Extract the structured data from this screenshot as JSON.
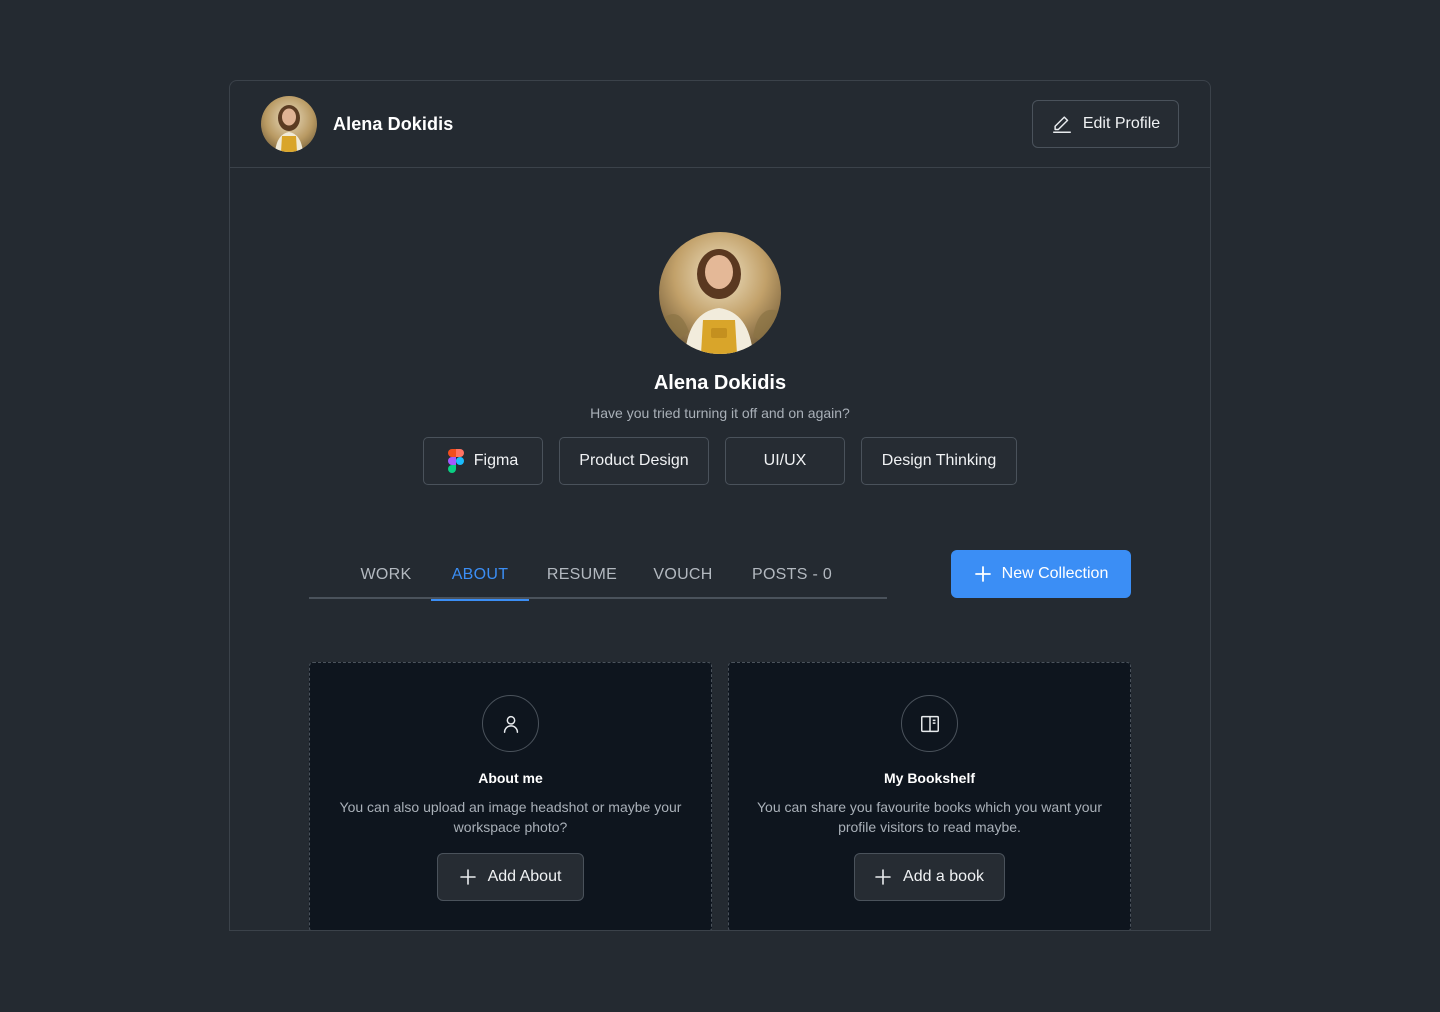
{
  "header": {
    "name": "Alena Dokidis",
    "edit_label": "Edit Profile"
  },
  "profile": {
    "name": "Alena Dokidis",
    "tagline": "Have you tried turning it off and on again?",
    "skills": [
      "Figma",
      "Product Design",
      "UI/UX",
      "Design Thinking"
    ]
  },
  "tabs": [
    {
      "label": "WORK",
      "active": false
    },
    {
      "label": "ABOUT",
      "active": true
    },
    {
      "label": "RESUME",
      "active": false
    },
    {
      "label": "VOUCH",
      "active": false
    },
    {
      "label": "POSTS - 0",
      "active": false
    }
  ],
  "new_collection_label": "New Collection",
  "panels": {
    "about": {
      "icon": "user-icon",
      "title": "About me",
      "description": "You can also upload an image headshot or maybe your workspace photo?",
      "button_label": "Add About"
    },
    "bookshelf": {
      "icon": "book-open-icon",
      "title": "My Bookshelf",
      "description": "You can share you favourite books which you want your profile visitors to read maybe.",
      "button_label": "Add a book"
    }
  },
  "colors": {
    "background": "#242a31",
    "panel": "#0e151e",
    "accent": "#3b8ef5",
    "border": "#4a525b"
  }
}
